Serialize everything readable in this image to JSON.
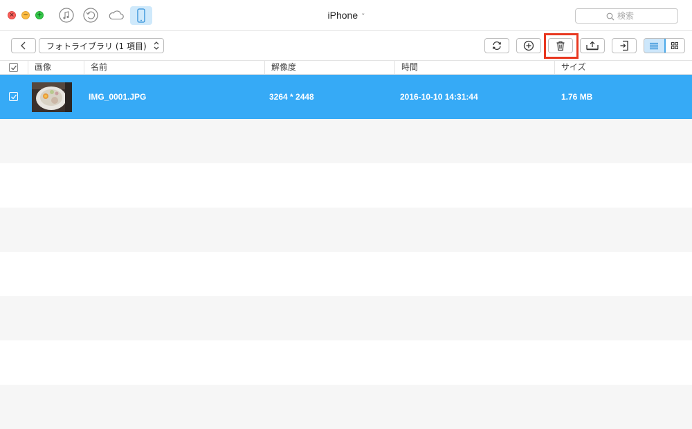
{
  "window": {
    "title": "iPhone",
    "caret": "ˇ"
  },
  "toolbar_icons": [
    "music-icon",
    "restore-icon",
    "cloud-icon",
    "phone-icon"
  ],
  "search": {
    "placeholder": "検索"
  },
  "toolbar": {
    "library_label": "フォトライブラリ (1 項目)"
  },
  "table": {
    "headers": [
      "画像",
      "名前",
      "解像度",
      "時間",
      "サイズ"
    ],
    "rows": [
      {
        "name": "IMG_0001.JPG",
        "resolution": "3264 * 2448",
        "time": "2016-10-10 14:31:44",
        "size": "1.76 MB",
        "selected": true
      }
    ]
  },
  "colors": {
    "selection": "#36aaf6",
    "highlight_box": "#e8371f",
    "stripe": "#f6f6f6"
  }
}
